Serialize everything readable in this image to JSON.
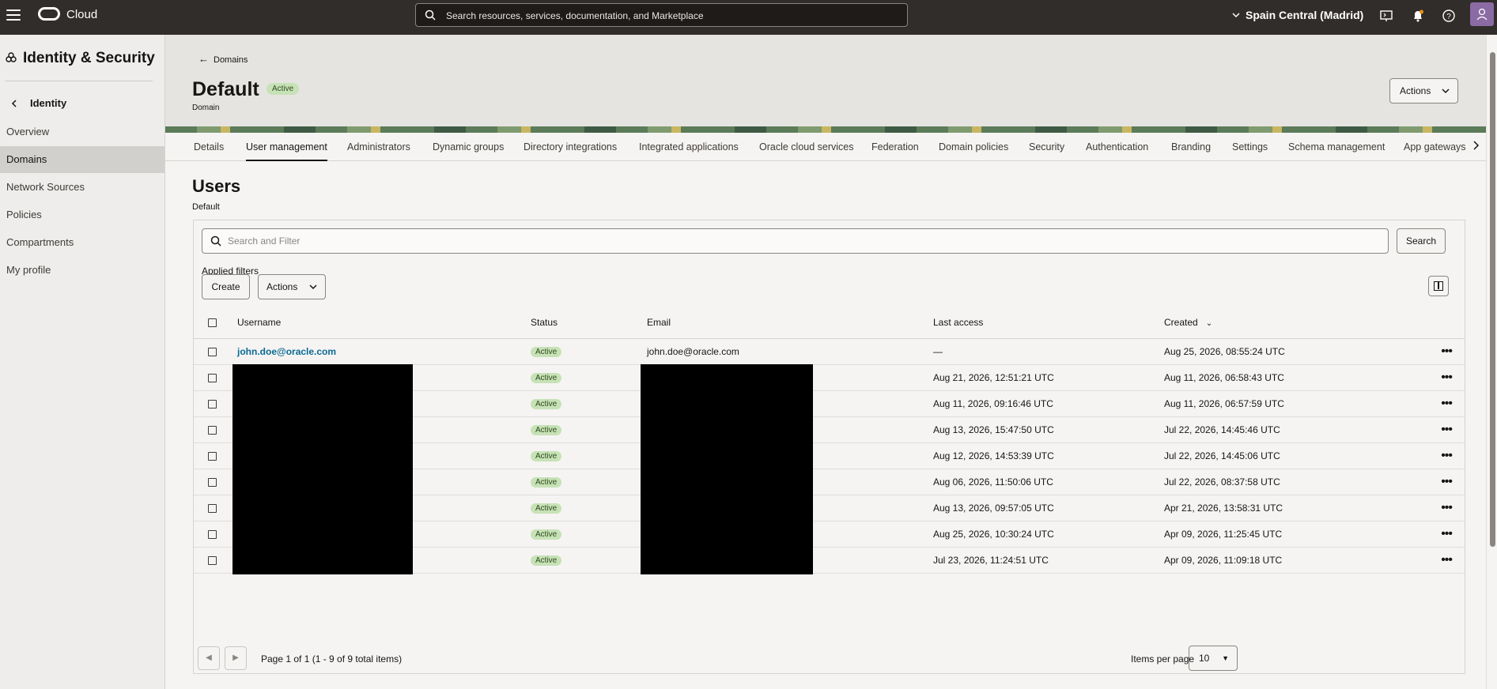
{
  "topbar": {
    "brand": "Cloud",
    "search_placeholder": "Search resources, services, documentation, and Marketplace",
    "region": "Spain Central (Madrid)"
  },
  "sidebar": {
    "title": "Identity & Security",
    "back_label": "Identity",
    "items": [
      {
        "label": "Overview"
      },
      {
        "label": "Domains"
      },
      {
        "label": "Network Sources"
      },
      {
        "label": "Policies"
      },
      {
        "label": "Compartments"
      },
      {
        "label": "My profile"
      }
    ]
  },
  "header": {
    "back_link": "Domains",
    "title": "Default",
    "status": "Active",
    "subtitle": "Domain",
    "actions_label": "Actions"
  },
  "tabs": [
    {
      "label": "Details"
    },
    {
      "label": "User management"
    },
    {
      "label": "Administrators"
    },
    {
      "label": "Dynamic groups"
    },
    {
      "label": "Directory integrations"
    },
    {
      "label": "Integrated applications"
    },
    {
      "label": "Oracle cloud services"
    },
    {
      "label": "Federation"
    },
    {
      "label": "Domain policies"
    },
    {
      "label": "Security"
    },
    {
      "label": "Authentication"
    },
    {
      "label": "Branding"
    },
    {
      "label": "Settings"
    },
    {
      "label": "Schema management"
    },
    {
      "label": "App gateways"
    }
  ],
  "users": {
    "title": "Users",
    "subtitle": "Default",
    "filter_placeholder": "Search and Filter",
    "search_button": "Search",
    "applied_filters": "Applied filters",
    "create_button": "Create",
    "actions_button": "Actions",
    "columns": {
      "username": "Username",
      "status": "Status",
      "email": "Email",
      "last_access": "Last access",
      "created": "Created"
    },
    "rows": [
      {
        "username": "john.doe@oracle.com",
        "status": "Active",
        "email": "john.doe@oracle.com",
        "last_access": "—",
        "created": "Aug 25, 2026, 08:55:24 UTC"
      },
      {
        "username": "",
        "status": "Active",
        "email": "",
        "last_access": "Aug 21, 2026, 12:51:21 UTC",
        "created": "Aug 11, 2026, 06:58:43 UTC"
      },
      {
        "username": "",
        "status": "Active",
        "email": "",
        "last_access": "Aug 11, 2026, 09:16:46 UTC",
        "created": "Aug 11, 2026, 06:57:59 UTC"
      },
      {
        "username": "",
        "status": "Active",
        "email": "",
        "last_access": "Aug 13, 2026, 15:47:50 UTC",
        "created": "Jul 22, 2026, 14:45:46 UTC"
      },
      {
        "username": "",
        "status": "Active",
        "email": "",
        "last_access": "Aug 12, 2026, 14:53:39 UTC",
        "created": "Jul 22, 2026, 14:45:06 UTC"
      },
      {
        "username": "",
        "status": "Active",
        "email": "",
        "last_access": "Aug 06, 2026, 11:50:06 UTC",
        "created": "Jul 22, 2026, 08:37:58 UTC"
      },
      {
        "username": "",
        "status": "Active",
        "email": "",
        "last_access": "Aug 13, 2026, 09:57:05 UTC",
        "created": "Apr 21, 2026, 13:58:31 UTC"
      },
      {
        "username": "",
        "status": "Active",
        "email": "",
        "last_access": "Aug 25, 2026, 10:30:24 UTC",
        "created": "Apr 09, 2026, 11:25:45 UTC"
      },
      {
        "username": "",
        "status": "Active",
        "email": "",
        "last_access": "Jul 23, 2026, 11:24:51 UTC",
        "created": "Apr 09, 2026, 11:09:18 UTC"
      }
    ],
    "pagination_text": "Page 1 of 1 (1 - 9 of 9 total items)",
    "items_per_page_label": "Items per page",
    "items_per_page_value": "10"
  },
  "icons": {
    "menu": "hamburger-icon",
    "search": "search-icon",
    "region_chevron": "chevron-down-icon",
    "cloud_shell": "cloud-shell-icon",
    "notifications": "bell-icon",
    "help": "help-icon",
    "profile": "avatar-icon",
    "row_actions": "kebab-icon"
  },
  "colors": {
    "topbar": "#312d2a",
    "status_active": "#c6e2b6",
    "link": "#0b6a94"
  }
}
